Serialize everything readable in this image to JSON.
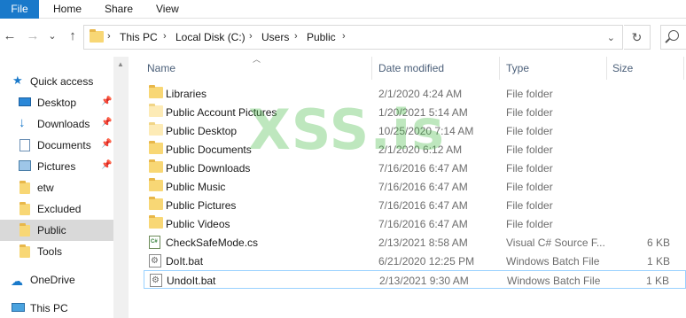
{
  "ribbon": {
    "tabs": [
      "File",
      "Home",
      "Share",
      "View"
    ]
  },
  "navigation": {
    "back": "←",
    "forward": "→",
    "recent": "⌄",
    "up": "↑"
  },
  "address": {
    "crumbs": [
      "This PC",
      "Local Disk (C:)",
      "Users",
      "Public"
    ],
    "separator": "›",
    "dropdown": "⌄",
    "refresh": "↻"
  },
  "navpane": {
    "items": [
      {
        "label": "Quick access",
        "icon": "star-icon",
        "pinned": false
      },
      {
        "label": "Desktop",
        "icon": "desktop-icon",
        "pinned": true
      },
      {
        "label": "Downloads",
        "icon": "download-icon",
        "pinned": true
      },
      {
        "label": "Documents",
        "icon": "documents-icon",
        "pinned": true
      },
      {
        "label": "Pictures",
        "icon": "pictures-icon",
        "pinned": true
      },
      {
        "label": "etw",
        "icon": "folder-icon",
        "pinned": false
      },
      {
        "label": "Excluded",
        "icon": "folder-icon",
        "pinned": false
      },
      {
        "label": "Public",
        "icon": "folder-icon",
        "pinned": false
      },
      {
        "label": "Tools",
        "icon": "folder-icon",
        "pinned": false
      },
      {
        "label": "OneDrive",
        "icon": "cloud-icon",
        "pinned": false
      },
      {
        "label": "This PC",
        "icon": "computer-icon",
        "pinned": false
      }
    ],
    "pin_glyph": "📌"
  },
  "columns": {
    "name": "Name",
    "date": "Date modified",
    "type": "Type",
    "size": "Size"
  },
  "files": [
    {
      "name": "Libraries",
      "date": "2/1/2020 4:24 AM",
      "type": "File folder",
      "size": "",
      "icon": "folder-icon"
    },
    {
      "name": "Public Account Pictures",
      "date": "1/20/2021 5:14 AM",
      "type": "File folder",
      "size": "",
      "icon": "folder-light-icon"
    },
    {
      "name": "Public Desktop",
      "date": "10/25/2020 7:14 AM",
      "type": "File folder",
      "size": "",
      "icon": "folder-light-icon"
    },
    {
      "name": "Public Documents",
      "date": "2/1/2020 6:12 AM",
      "type": "File folder",
      "size": "",
      "icon": "folder-icon"
    },
    {
      "name": "Public Downloads",
      "date": "7/16/2016 6:47 AM",
      "type": "File folder",
      "size": "",
      "icon": "folder-icon"
    },
    {
      "name": "Public Music",
      "date": "7/16/2016 6:47 AM",
      "type": "File folder",
      "size": "",
      "icon": "folder-icon"
    },
    {
      "name": "Public Pictures",
      "date": "7/16/2016 6:47 AM",
      "type": "File folder",
      "size": "",
      "icon": "folder-icon"
    },
    {
      "name": "Public Videos",
      "date": "7/16/2016 6:47 AM",
      "type": "File folder",
      "size": "",
      "icon": "folder-icon"
    },
    {
      "name": "CheckSafeMode.cs",
      "date": "2/13/2021 8:58 AM",
      "type": "Visual C# Source F...",
      "size": "6 KB",
      "icon": "csharp-file-icon"
    },
    {
      "name": "DoIt.bat",
      "date": "6/21/2020 12:25 PM",
      "type": "Windows Batch File",
      "size": "1 KB",
      "icon": "batch-file-icon"
    },
    {
      "name": "UndoIt.bat",
      "date": "2/13/2021 9:30 AM",
      "type": "Windows Batch File",
      "size": "1 KB",
      "icon": "batch-file-icon"
    }
  ],
  "watermark": "XSS.is",
  "colors": {
    "file_tab": "#1979ca",
    "selected_nav": "#d9d9d9",
    "header_text": "#4c607a"
  }
}
